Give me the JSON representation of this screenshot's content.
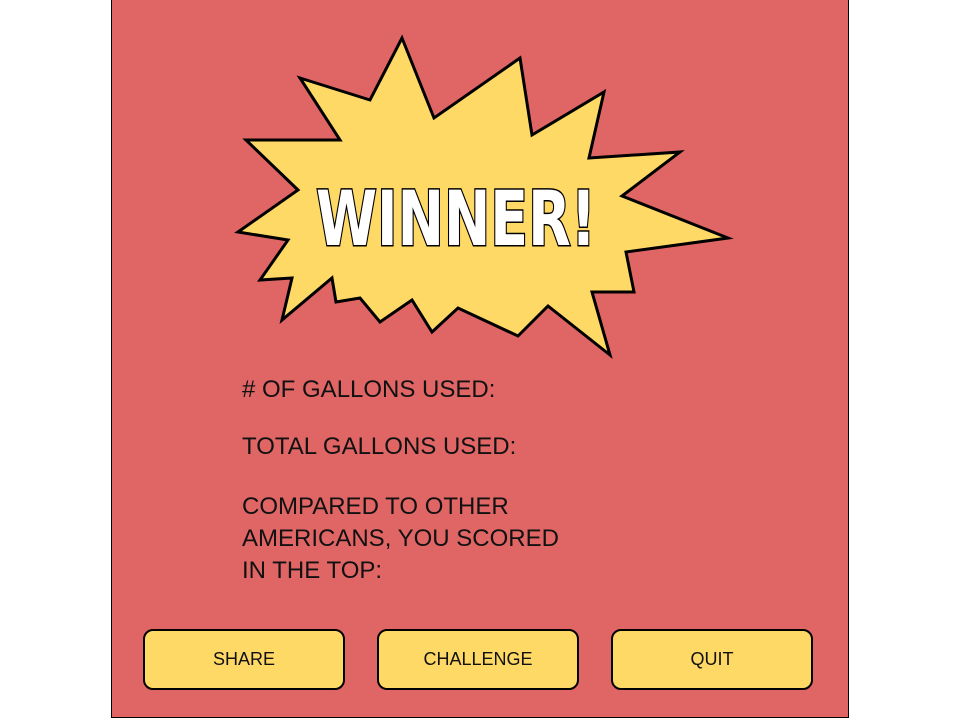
{
  "colors": {
    "background": "#e06666",
    "burst_fill": "#ffd966",
    "button_fill": "#ffd966",
    "outline": "#000000",
    "headline_fill": "#ffffff"
  },
  "headline": {
    "text": "WINNER!",
    "icon": "starburst-icon"
  },
  "stats": {
    "gallons_used_label": "# OF GALLONS USED:",
    "total_gallons_label": "TOTAL GALLONS USED:",
    "compared_label": "COMPARED TO OTHER AMERICANS, YOU SCORED IN THE TOP:"
  },
  "buttons": {
    "share": "SHARE",
    "challenge": "CHALLENGE",
    "quit": "QUIT"
  }
}
